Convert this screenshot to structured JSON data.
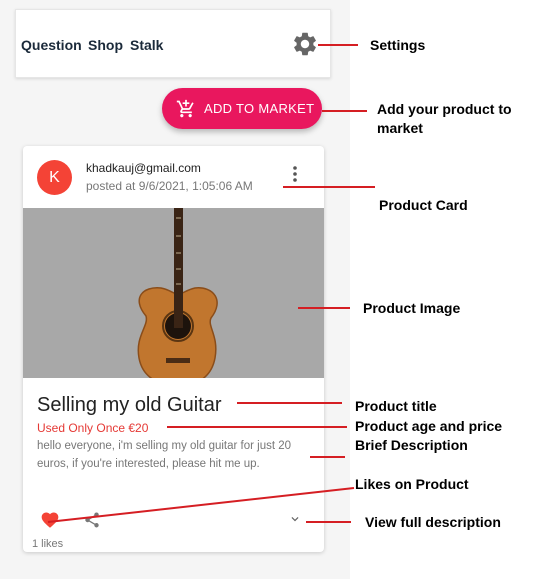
{
  "header": {
    "nav": [
      "Question",
      "Shop",
      "Stalk"
    ],
    "settings_icon": "gear-icon"
  },
  "add_button": {
    "label": "ADD TO MARKET",
    "icon": "add-cart-icon",
    "color": "#e9175e"
  },
  "card": {
    "avatar_letter": "K",
    "avatar_color": "#f44336",
    "email": "khadkauj@gmail.com",
    "posted": "posted at 9/6/2021, 1:05:06 AM",
    "title": "Selling my old Guitar",
    "subtitle": "Used Only Once €20",
    "description": "hello everyone, i'm selling my old guitar for just 20 euros, if you're interested, please hit me up.",
    "likes": "1 likes"
  },
  "annotations": [
    "Settings",
    "Add your product to market",
    "Product Card",
    "Product Image",
    "Product title",
    "Product age and price",
    "Brief Description",
    "Likes on Product",
    "View full description"
  ],
  "colors": {
    "accent": "#e9175e",
    "annotation_line": "#d51e23",
    "price_text": "#e53935"
  }
}
